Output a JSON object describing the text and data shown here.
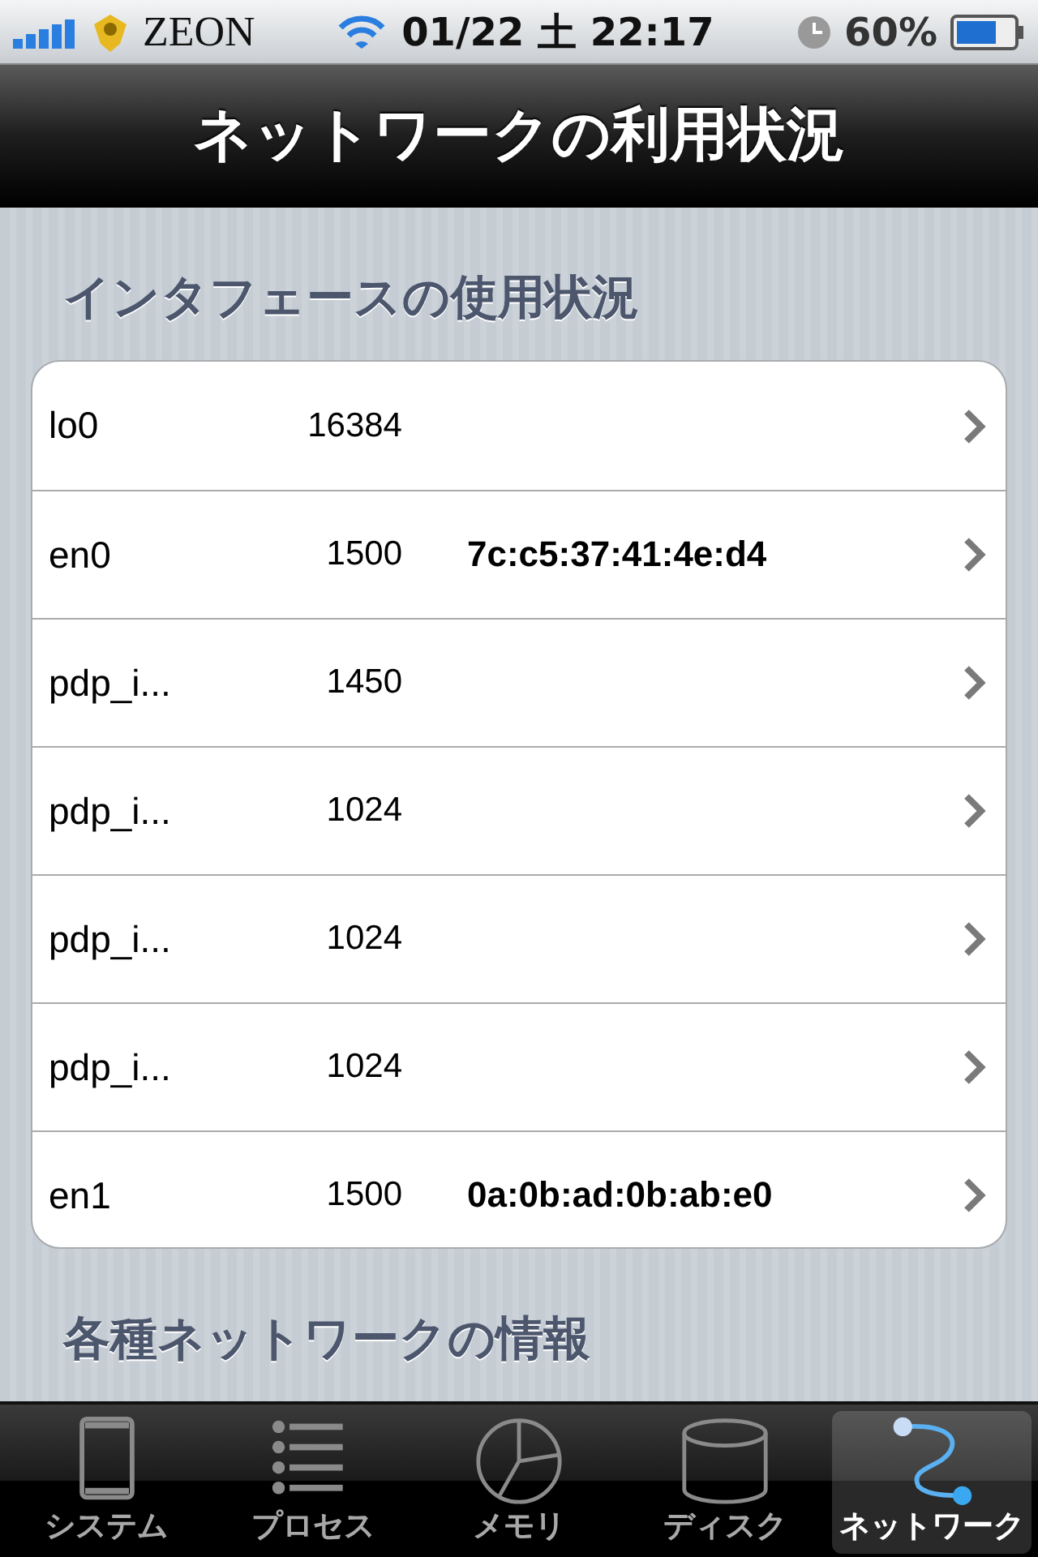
{
  "status_bar": {
    "carrier": "ZEON",
    "time": "01/22 土 22:17",
    "battery": "60%"
  },
  "nav_bar": {
    "title": "ネットワークの利用状況"
  },
  "sections": [
    {
      "title": "インタフェースの使用状況",
      "rows": [
        {
          "name": "lo0",
          "mtu": "16384"
        },
        {
          "name": "en0",
          "mtu": "1500",
          "address": "7c:c5:37:41:4e:d4"
        },
        {
          "name": "pdp_i...",
          "mtu": "1450"
        },
        {
          "name": "pdp_i...",
          "mtu": "1024"
        },
        {
          "name": "pdp_i...",
          "mtu": "1024"
        },
        {
          "name": "pdp_i...",
          "mtu": "1024"
        },
        {
          "name": "en1",
          "mtu": "1500",
          "address": "0a:0b:ad:0b:ab:e0"
        }
      ]
    },
    {
      "title": "各種ネットワークの情報"
    }
  ],
  "tab_bar": [
    {
      "kind": "phone",
      "label": "システム",
      "selected": false
    },
    {
      "kind": "list",
      "label": "プロセス",
      "selected": false
    },
    {
      "kind": "pie",
      "label": "メモリ",
      "selected": false
    },
    {
      "kind": "disk",
      "label": "ディスク",
      "selected": false
    },
    {
      "kind": "network",
      "label": "ネットワーク",
      "selected": true
    }
  ]
}
